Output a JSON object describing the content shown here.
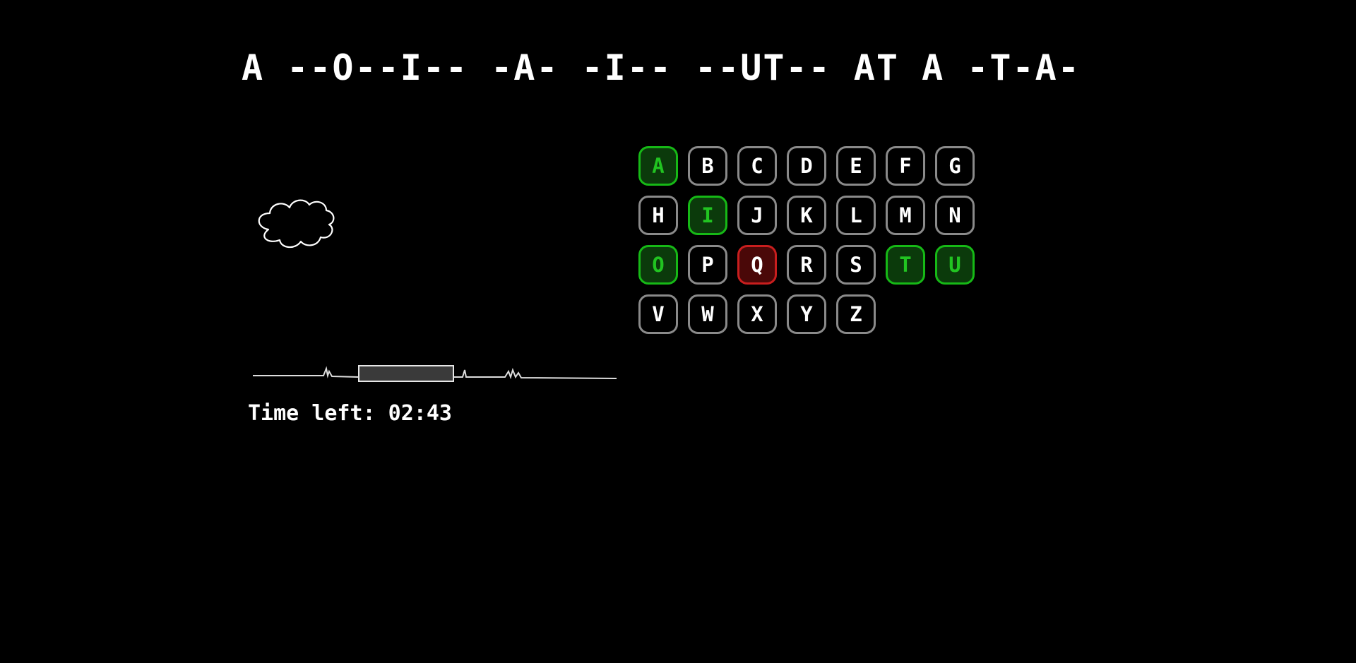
{
  "puzzle": {
    "masked_phrase": "A --O--I-- -A- -I-- --UT-- AT A -T-A-"
  },
  "timer": {
    "label": "Time left: 02:43"
  },
  "keyboard": {
    "keys": [
      {
        "letter": "A",
        "state": "correct"
      },
      {
        "letter": "B",
        "state": "unused"
      },
      {
        "letter": "C",
        "state": "unused"
      },
      {
        "letter": "D",
        "state": "unused"
      },
      {
        "letter": "E",
        "state": "unused"
      },
      {
        "letter": "F",
        "state": "unused"
      },
      {
        "letter": "G",
        "state": "unused"
      },
      {
        "letter": "H",
        "state": "unused"
      },
      {
        "letter": "I",
        "state": "correct"
      },
      {
        "letter": "J",
        "state": "unused"
      },
      {
        "letter": "K",
        "state": "unused"
      },
      {
        "letter": "L",
        "state": "unused"
      },
      {
        "letter": "M",
        "state": "unused"
      },
      {
        "letter": "N",
        "state": "unused"
      },
      {
        "letter": "O",
        "state": "correct"
      },
      {
        "letter": "P",
        "state": "unused"
      },
      {
        "letter": "Q",
        "state": "wrong"
      },
      {
        "letter": "R",
        "state": "unused"
      },
      {
        "letter": "S",
        "state": "unused"
      },
      {
        "letter": "T",
        "state": "correct"
      },
      {
        "letter": "U",
        "state": "correct"
      },
      {
        "letter": "V",
        "state": "unused"
      },
      {
        "letter": "W",
        "state": "unused"
      },
      {
        "letter": "X",
        "state": "unused"
      },
      {
        "letter": "Y",
        "state": "unused"
      },
      {
        "letter": "Z",
        "state": "unused"
      }
    ]
  },
  "colors": {
    "background": "#000000",
    "correct": "#16b916",
    "wrong": "#c81e1e",
    "neutral_border": "#8a8a8a"
  }
}
